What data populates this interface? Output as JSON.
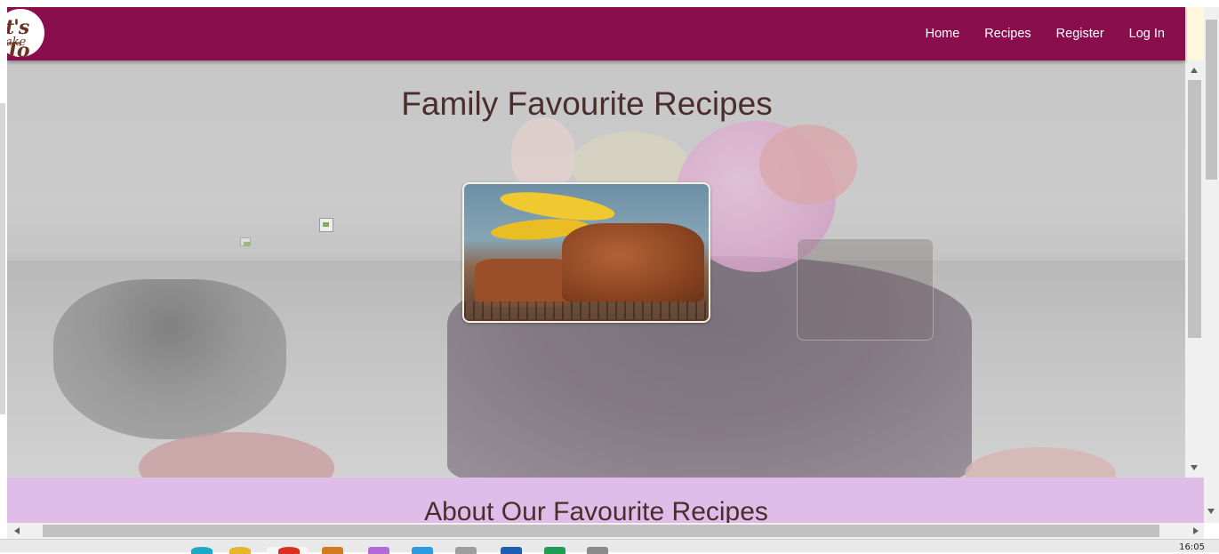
{
  "brand": {
    "logo_alt": "It's To Bake",
    "logo_line1": "t's To",
    "logo_line2": "ake",
    "nav_bg": "#8a0d4e"
  },
  "nav": {
    "items": [
      {
        "label": "Home"
      },
      {
        "label": "Recipes"
      },
      {
        "label": "Register"
      },
      {
        "label": "Log In"
      }
    ]
  },
  "hero": {
    "title": "Family Favourite Recipes",
    "featured_image": "banana-bread-photo",
    "broken_image_icon": "broken-image-icon"
  },
  "about": {
    "title": "About Our Favourite Recipes",
    "band_color": "#e0bde8"
  },
  "taskbar": {
    "clock": "16:05"
  }
}
